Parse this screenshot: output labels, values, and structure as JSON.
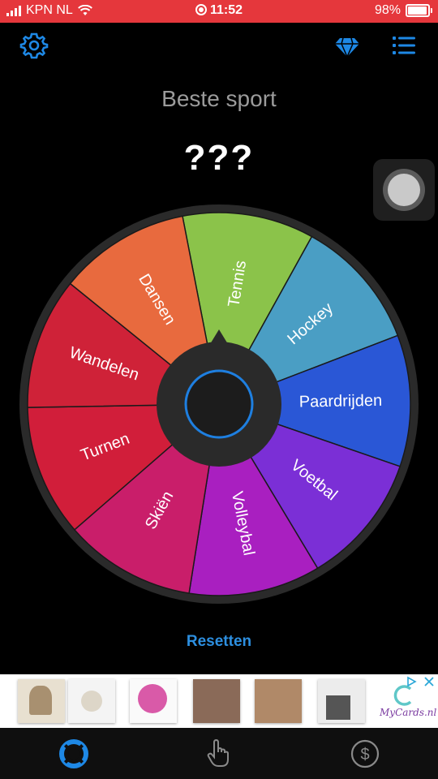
{
  "status": {
    "carrier": "KPN NL",
    "time": "11:52",
    "battery": "98%"
  },
  "header": {
    "settings_icon": "gear-icon",
    "premium_icon": "diamond-icon",
    "menu_icon": "list-icon"
  },
  "title": "Beste sport",
  "result": "???",
  "wheel": {
    "segments": [
      {
        "label": "Tennis",
        "color": "#8bc34a"
      },
      {
        "label": "Hockey",
        "color": "#4a9ec4"
      },
      {
        "label": "Paardrijden",
        "color": "#2a57d6"
      },
      {
        "label": "Voetbal",
        "color": "#7b2fd6"
      },
      {
        "label": "Volleybal",
        "color": "#a91fc0"
      },
      {
        "label": "Skiën",
        "color": "#c91e6a"
      },
      {
        "label": "Turnen",
        "color": "#d11e3a"
      },
      {
        "label": "Wandelen",
        "color": "#cf2238"
      },
      {
        "label": "Dansen",
        "color": "#e86a3e"
      }
    ],
    "rim_color": "#2a2a2a",
    "hub_ring_color": "#1e7fe0"
  },
  "reset_label": "Resetten",
  "ad": {
    "brand": "MyCards.nl"
  },
  "tabs": [
    {
      "name": "wheel-tab",
      "icon": "lifebuoy-icon",
      "active": true
    },
    {
      "name": "pick-tab",
      "icon": "hand-pointer-icon",
      "active": false
    },
    {
      "name": "premium-tab",
      "icon": "dollar-icon",
      "active": false
    }
  ],
  "accent_color": "#1e88e5"
}
